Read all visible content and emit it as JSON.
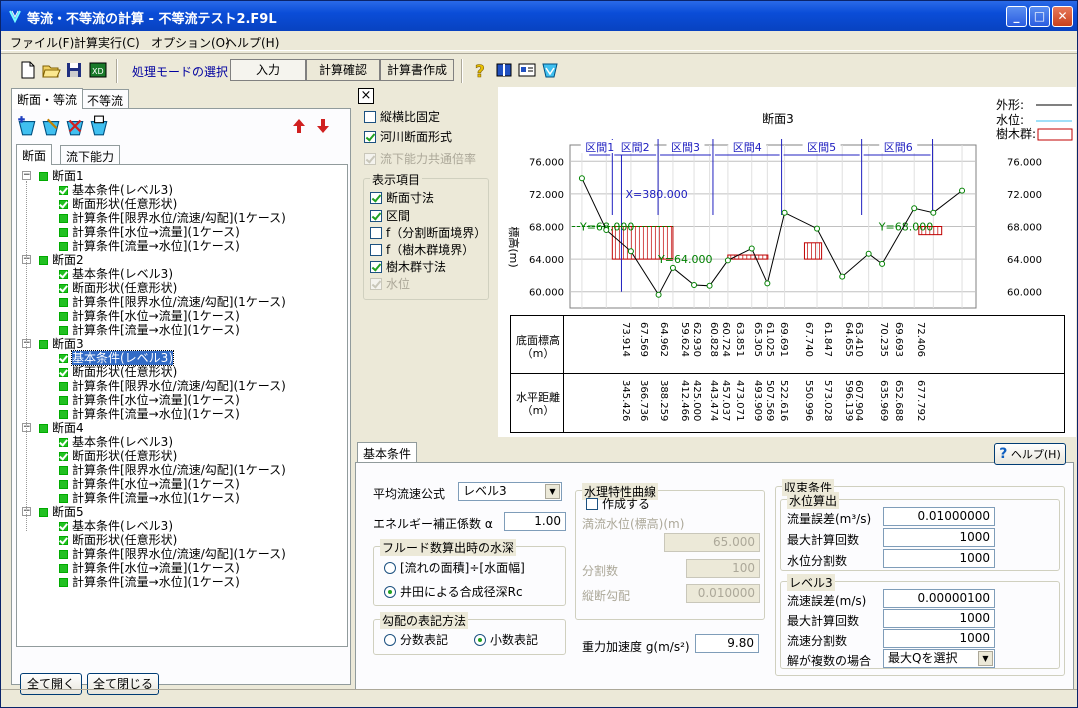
{
  "window": {
    "title": "等流・不等流の計算 - 不等流テスト2.F9L"
  },
  "menu": [
    "ファイル(F)",
    "計算実行(C)",
    "オプション(O)",
    "ヘルプ(H)"
  ],
  "toolbar": {
    "mode_label": "処理モードの選択",
    "modes": [
      "入力",
      "計算確認",
      "計算書作成"
    ]
  },
  "left": {
    "tabs": [
      "断面・等流",
      "不等流"
    ],
    "subtabs": [
      "断面",
      "流下能力"
    ],
    "tree": [
      {
        "label": "断面1",
        "children": [
          "基本条件(レベル3)",
          "断面形状(任意形状)",
          "計算条件[限界水位/流速/勾配](1ケース)",
          "計算条件[水位→流量](1ケース)",
          "計算条件[流量→水位](1ケース)"
        ]
      },
      {
        "label": "断面2",
        "children": [
          "基本条件(レベル3)",
          "断面形状(任意形状)",
          "計算条件[限界水位/流速/勾配](1ケース)",
          "計算条件[水位→流量](1ケース)",
          "計算条件[流量→水位](1ケース)"
        ]
      },
      {
        "label": "断面3",
        "children": [
          "基本条件(レベル3)",
          "断面形状(任意形状)",
          "計算条件[限界水位/流速/勾配](1ケース)",
          "計算条件[水位→流量](1ケース)",
          "計算条件[流量→水位](1ケース)"
        ]
      },
      {
        "label": "断面4",
        "children": [
          "基本条件(レベル3)",
          "断面形状(任意形状)",
          "計算条件[限界水位/流速/勾配](1ケース)",
          "計算条件[水位→流量](1ケース)",
          "計算条件[流量→水位](1ケース)"
        ]
      },
      {
        "label": "断面5",
        "children": [
          "基本条件(レベル3)",
          "断面形状(任意形状)",
          "計算条件[限界水位/流速/勾配](1ケース)",
          "計算条件[水位→流量](1ケース)",
          "計算条件[流量→水位](1ケース)"
        ]
      }
    ],
    "expand_all": "全て開く",
    "collapse_all": "全て閉じる"
  },
  "options": {
    "close": "×",
    "fixed_ratio": "縦横比固定",
    "river_section": "河川断面形式",
    "common_ratio": "流下能力共通倍率",
    "display_group": "表示項目",
    "items": [
      "断面寸法",
      "区間",
      "f（分割断面境界）",
      "f（樹木群境界）",
      "樹木群寸法",
      "水位"
    ]
  },
  "chart": {
    "title": "断面3",
    "ylabel": "標高(m)",
    "legend": [
      "外形:",
      "水位:",
      "樹木群:"
    ],
    "yticks": [
      "76.000",
      "72.000",
      "68.000",
      "64.000",
      "60.000"
    ],
    "zones": [
      "区間1",
      "区間2",
      "区間3",
      "区間4",
      "区間5",
      "区間6"
    ],
    "annotations": {
      "x": "X=380.000",
      "y1": "Y=68.000",
      "y2": "Y=64.000",
      "y3": "Y=68.000"
    },
    "row_labels": [
      "底面標高\n（m）",
      "水平距離\n（m）"
    ],
    "elevations": [
      "73.914",
      "67.569",
      "64.962",
      "59.624",
      "62.930",
      "60.828",
      "60.724",
      "63.851",
      "65.305",
      "61.025",
      "69.691",
      "67.740",
      "61.847",
      "64.655",
      "63.410",
      "70.235",
      "69.693",
      "72.406"
    ],
    "distances": [
      "345.426",
      "366.736",
      "388.259",
      "412.466",
      "425.000",
      "443.474",
      "457.037",
      "473.071",
      "493.909",
      "507.569",
      "522.616",
      "550.996",
      "573.028",
      "596.139",
      "607.904",
      "635.969",
      "652.688",
      "677.792"
    ]
  },
  "chart_data": {
    "type": "line",
    "title": "断面3",
    "ylabel": "標高(m)",
    "ylim": [
      58,
      78
    ],
    "x": [
      345.426,
      366.736,
      388.259,
      412.466,
      425.0,
      443.474,
      457.037,
      473.071,
      493.909,
      507.569,
      522.616,
      550.996,
      573.028,
      596.139,
      607.904,
      635.969,
      652.688,
      677.792
    ],
    "series": [
      {
        "name": "外形",
        "values": [
          73.914,
          67.569,
          64.962,
          59.624,
          62.93,
          60.828,
          60.724,
          63.851,
          65.305,
          61.025,
          69.691,
          67.74,
          61.847,
          64.655,
          63.41,
          70.235,
          69.693,
          72.406
        ]
      }
    ]
  },
  "basic": {
    "tab": "基本条件",
    "help": "ヘルプ(H)",
    "formula_label": "平均流速公式",
    "formula_value": "レベル3",
    "energy_label": "エネルギー補正係数 α",
    "energy_value": "1.00",
    "froude_group": "フルード数算出時の水深",
    "froude_opt1": "[流れの面積]÷[水面幅]",
    "froude_opt2": "井田による合成径深Rc",
    "slope_group": "勾配の表記方法",
    "slope_opt1": "分数表記",
    "slope_opt2": "小数表記",
    "hyd_group": "水理特性曲線",
    "hyd_create": "作成する",
    "full_level_label": "満流水位(標高)(m)",
    "full_level": "65.000",
    "div_label": "分割数",
    "div_value": "100",
    "slope_label": "縦断勾配",
    "slope_value": "0.010000",
    "gravity_label": "重力加速度 g(m/s²)",
    "gravity_value": "9.80",
    "conv_group": "収束条件",
    "wl_group": "水位算出",
    "flow_err_label": "流量誤差(m³/s)",
    "flow_err": "0.01000000",
    "max_iter_label": "最大計算回数",
    "max_iter": "1000",
    "wl_div_label": "水位分割数",
    "wl_div": "1000",
    "lv3_group": "レベル3",
    "vel_err_label": "流速誤差(m/s)",
    "vel_err": "0.00000100",
    "max_iter2_label": "最大計算回数",
    "max_iter2": "1000",
    "vel_div_label": "流速分割数",
    "vel_div": "1000",
    "multi_label": "解が複数の場合",
    "multi_value": "最大Qを選択"
  }
}
